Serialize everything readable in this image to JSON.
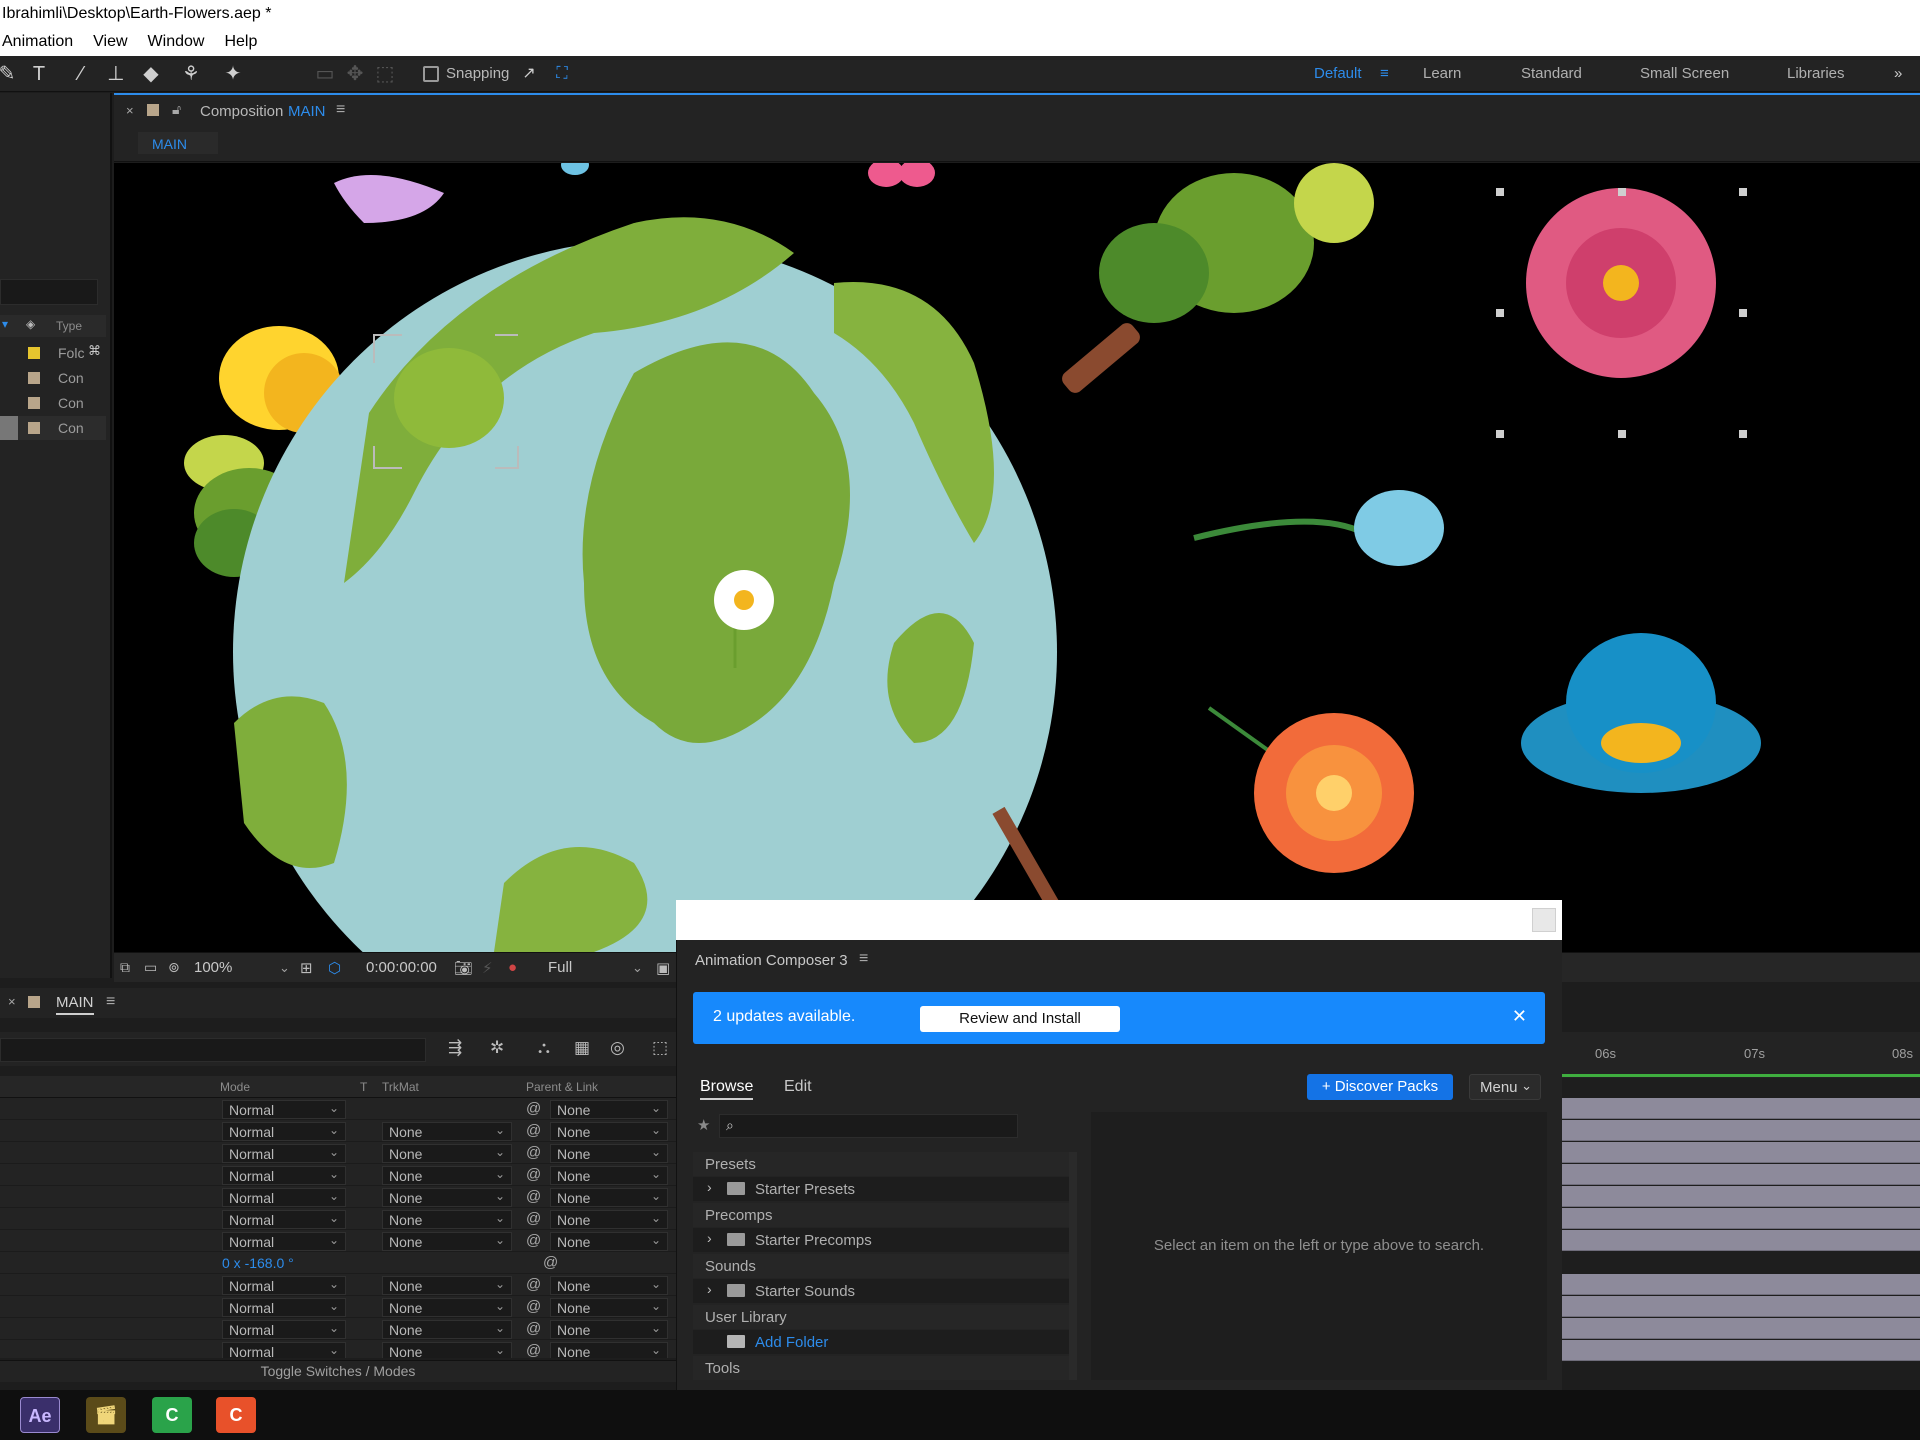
{
  "window": {
    "title": "Ibrahimli\\Desktop\\Earth-Flowers.aep *"
  },
  "menu": [
    "Animation",
    "View",
    "Window",
    "Help"
  ],
  "toolbar": {
    "snapping_label": "Snapping",
    "workspaces": [
      "Default",
      "Learn",
      "Standard",
      "Small Screen",
      "Libraries"
    ],
    "more": "»"
  },
  "project_panel": {
    "column_type": "Type",
    "items": [
      "Folc",
      "Con",
      "Con",
      "Con"
    ]
  },
  "composition": {
    "tab_prefix": "Composition",
    "tab_name": "MAIN",
    "chip": "MAIN",
    "zoom": "100%",
    "timecode": "0:00:00:00",
    "resolution": "Full"
  },
  "timeline": {
    "tab": "MAIN",
    "columns": {
      "mode": "Mode",
      "t": "T",
      "trkmat": "TrkMat",
      "parent": "Parent & Link"
    },
    "rows": [
      {
        "mode": "Normal",
        "trkmat": "",
        "parent": "None"
      },
      {
        "mode": "Normal",
        "trkmat": "None",
        "parent": "None"
      },
      {
        "mode": "Normal",
        "trkmat": "None",
        "parent": "None"
      },
      {
        "mode": "Normal",
        "trkmat": "None",
        "parent": "None"
      },
      {
        "mode": "Normal",
        "trkmat": "None",
        "parent": "None"
      },
      {
        "mode": "Normal",
        "trkmat": "None",
        "parent": "None"
      },
      {
        "mode": "Normal",
        "trkmat": "None",
        "parent": "None"
      },
      {
        "rotation": "0 x -168.0 °"
      },
      {
        "mode": "Normal",
        "trkmat": "None",
        "parent": "None"
      },
      {
        "mode": "Normal",
        "trkmat": "None",
        "parent": "None"
      },
      {
        "mode": "Normal",
        "trkmat": "None",
        "parent": "None"
      },
      {
        "mode": "Normal",
        "trkmat": "None",
        "parent": "None"
      }
    ],
    "toggle_label": "Toggle Switches / Modes",
    "ruler": [
      "06s",
      "07s",
      "08s"
    ]
  },
  "animation_composer": {
    "title": "Animation Composer 3",
    "banner_text": "2 updates available.",
    "review_button": "Review and Install",
    "tabs": [
      "Browse",
      "Edit"
    ],
    "discover_button": "+ Discover Packs",
    "menu_button": "Menu",
    "sections": {
      "presets": "Presets",
      "starter_presets": "Starter Presets",
      "precomps": "Precomps",
      "starter_precomps": "Starter Precomps",
      "sounds": "Sounds",
      "starter_sounds": "Starter Sounds",
      "user_library": "User Library",
      "add_folder": "Add Folder",
      "tools": "Tools"
    },
    "hint": "Select an item on the left or type above to search."
  },
  "taskbar": {
    "ae": "Ae"
  },
  "colors": {
    "accent": "#2d8ceb",
    "banner": "#1789fc",
    "discover": "#1473e6"
  }
}
